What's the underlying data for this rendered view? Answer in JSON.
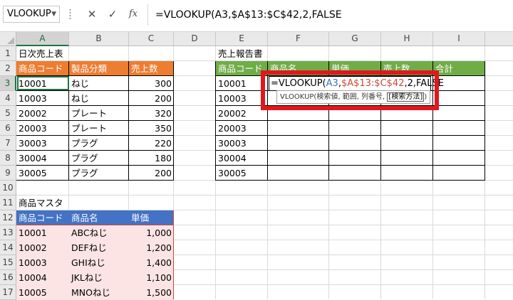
{
  "formula_bar": {
    "name_box": "VLOOKUP",
    "cancel_glyph": "✕",
    "enter_glyph": "✓",
    "fx_glyph": "fx",
    "formula": "=VLOOKUP(A3,$A$13:$C$42,2,FALSE"
  },
  "columns": [
    "A",
    "B",
    "C",
    "D",
    "E",
    "F",
    "G",
    "H",
    "I"
  ],
  "rows": [
    "1",
    "2",
    "3",
    "4",
    "5",
    "6",
    "7",
    "8",
    "9",
    "10",
    "11",
    "12",
    "13",
    "14",
    "15",
    "16",
    "17"
  ],
  "daily_sales": {
    "title": "日次売上表",
    "headers": [
      "商品コード",
      "製品分類",
      "売上数"
    ],
    "rows": [
      [
        "10001",
        "ねじ",
        "300"
      ],
      [
        "10003",
        "ねじ",
        "200"
      ],
      [
        "20002",
        "プレート",
        "320"
      ],
      [
        "20003",
        "プレート",
        "350"
      ],
      [
        "30003",
        "プラグ",
        "220"
      ],
      [
        "30004",
        "プラグ",
        "180"
      ],
      [
        "30005",
        "プラグ",
        "200"
      ]
    ]
  },
  "sales_report": {
    "title": "売上報告書",
    "headers": [
      "商品コード",
      "商品名",
      "単価",
      "売上数",
      "合計"
    ],
    "codes": [
      "10001",
      "10003",
      "20002",
      "20003",
      "30003",
      "30004",
      "30005"
    ]
  },
  "product_master": {
    "title": "商品マスタ",
    "headers": [
      "商品コード",
      "商品名",
      "単価"
    ],
    "rows": [
      [
        "10001",
        "ABCねじ",
        "1,000"
      ],
      [
        "10002",
        "DEFねじ",
        "1,200"
      ],
      [
        "10003",
        "GHIねじ",
        "1,400"
      ],
      [
        "10004",
        "JKLねじ",
        "1,100"
      ],
      [
        "10005",
        "MNOねじ",
        "1,500"
      ]
    ]
  },
  "editing": {
    "part_start": "=VLOOKUP(",
    "part_ref": "A3",
    "part_sep": ",",
    "part_range": "$A$13:$C$42",
    "part_end": ",2,FALSE",
    "tooltip_main": "VLOOKUP(検索値, 範囲, 列番号, ",
    "tooltip_optional": "[検索方法]",
    "tooltip_close": ")"
  },
  "colors": {
    "orange": "#ed7d31",
    "green": "#70ad47",
    "blue": "#4472c4",
    "pink": "#fce4e4",
    "highlight": "#e2171e",
    "excel_green": "#217346"
  }
}
